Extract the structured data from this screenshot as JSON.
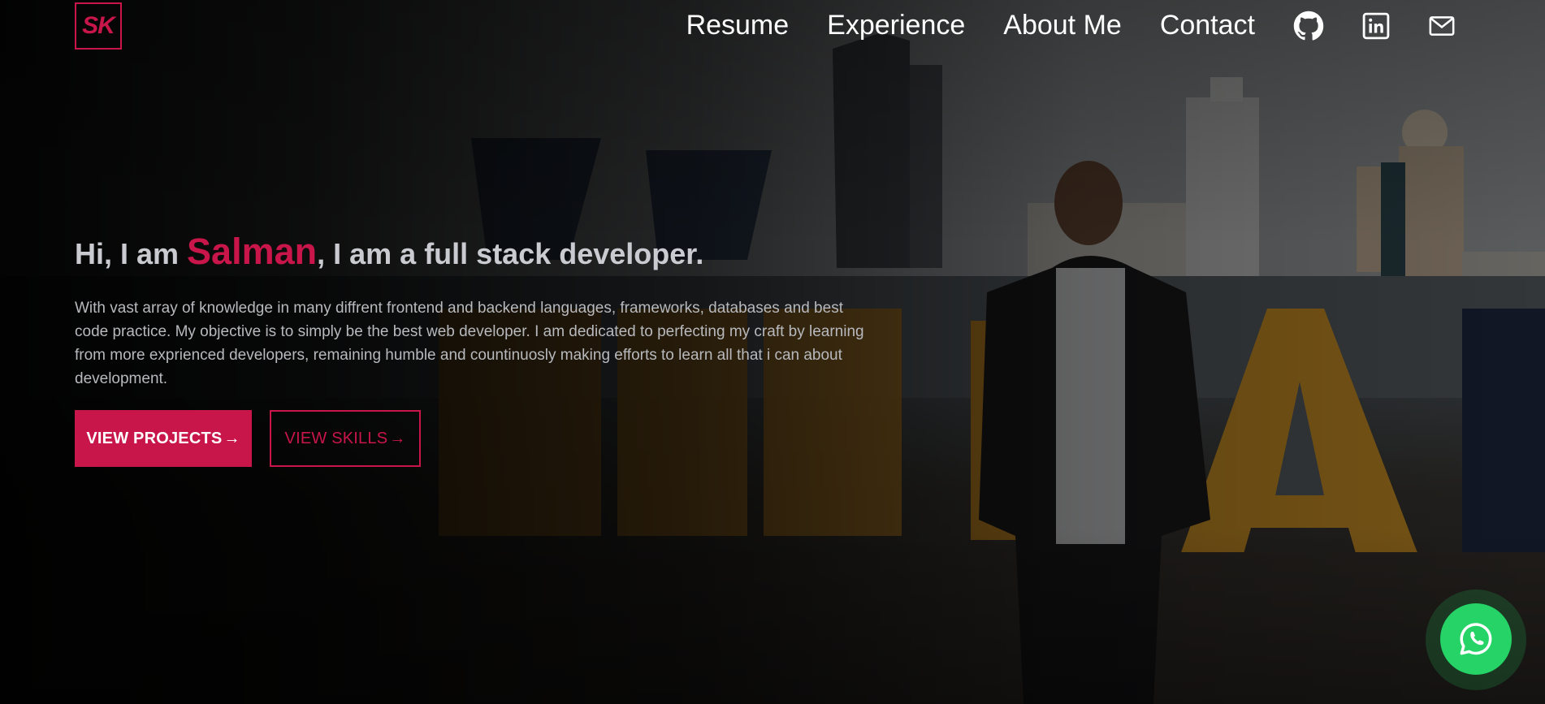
{
  "brand": {
    "logo_text": "SK",
    "accent_color": "#c8154a"
  },
  "nav": {
    "items": [
      {
        "label": "Resume"
      },
      {
        "label": "Experience"
      },
      {
        "label": "About Me"
      },
      {
        "label": "Contact"
      }
    ],
    "icons": [
      "github-icon",
      "linkedin-icon",
      "mail-icon"
    ]
  },
  "hero": {
    "greeting": "Hi, I am ",
    "name": "Salman",
    "tagline": ", I am a full stack developer.",
    "description": "With vast array of knowledge in many diffrent frontend and backend languages, frameworks, databases and best code practice. My objective is to simply be the best web developer. I am dedicated to perfecting my craft by learning from more exprienced developers, remaining humble and countinuosly making efforts to learn all that i can about development.",
    "primary_button": "VIEW PROJECTS",
    "secondary_button": "VIEW SKILLS",
    "button_arrow": "→"
  },
  "floating": {
    "whatsapp_icon": "whatsapp-icon",
    "color": "#25d366"
  }
}
